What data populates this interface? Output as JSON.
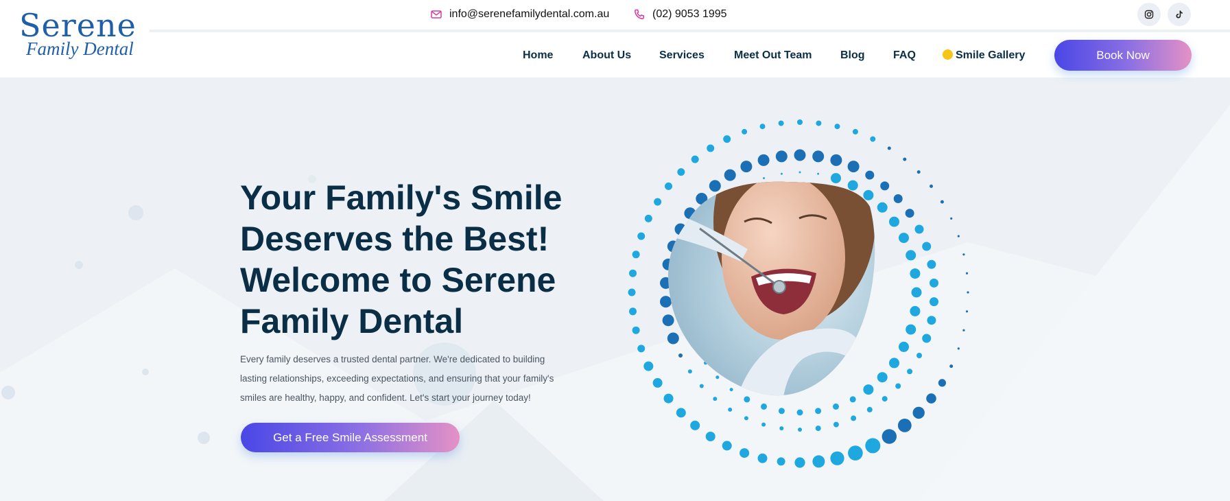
{
  "brand": {
    "name_top": "Serene",
    "name_bottom": "Family Dental"
  },
  "contact": {
    "email": "info@serenefamilydental.com.au",
    "phone": "(02) 9053 1995",
    "email_icon": "mail-icon",
    "phone_icon": "phone-icon"
  },
  "social": {
    "instagram_icon": "instagram-icon",
    "tiktok_icon": "tiktok-icon"
  },
  "nav": {
    "items": [
      "Home",
      "About Us",
      "Services",
      "Meet Out Team",
      "Blog",
      "FAQ",
      "Smile Gallery"
    ],
    "smile_gallery_icon": "smile-emoji-icon",
    "book_label": "Book Now"
  },
  "hero": {
    "headline_lines": [
      "Your Family's Smile",
      "Deserves the Best!",
      "Welcome to Serene",
      "Family Dental"
    ],
    "body_lines": [
      "Every family deserves a trusted dental partner. We're dedicated to building",
      "lasting relationships, exceeding expectations, and ensuring that your family's",
      "smiles are healthy, happy, and confident. Let's start your journey today!"
    ],
    "cta_label": "Get a Free Smile Assessment",
    "image_icon": "smiling-patient-photo"
  },
  "colors": {
    "navy": "#0a2e45",
    "accent_gradient_start": "#4a47e6",
    "accent_gradient_end": "#e591c5",
    "dot_light": "#1fa7e0",
    "dot_dark": "#1b6fb5",
    "hero_bg": "#edf1f5",
    "logo_blue": "#1f5fa8"
  }
}
